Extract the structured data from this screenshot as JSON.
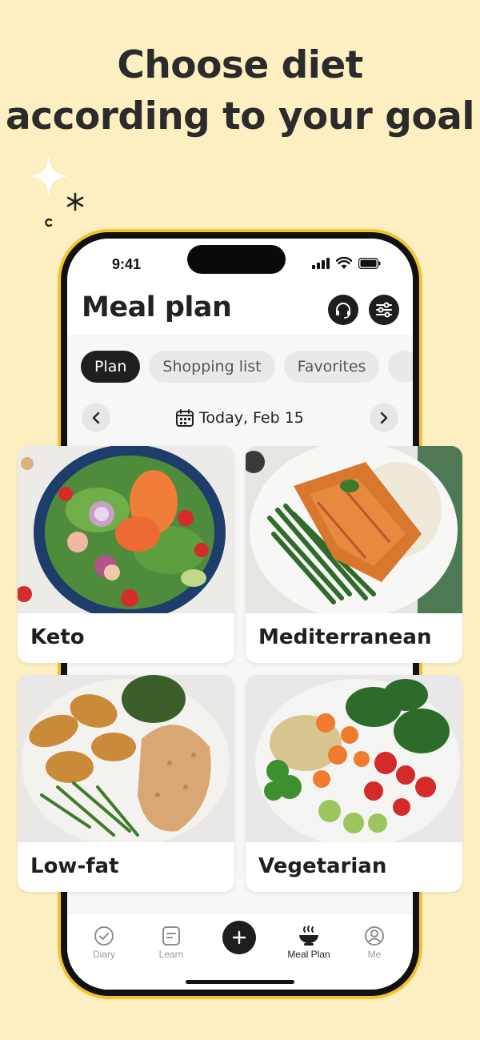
{
  "headline": {
    "line1": "Choose diet",
    "line2": "according to your goal"
  },
  "status_bar": {
    "time": "9:41",
    "icons": [
      "signal-icon",
      "wifi-icon",
      "battery-icon"
    ]
  },
  "header": {
    "title": "Meal plan",
    "buttons": [
      "support-icon",
      "filter-icon"
    ]
  },
  "tabs": [
    {
      "label": "Plan",
      "active": true
    },
    {
      "label": "Shopping list",
      "active": false
    },
    {
      "label": "Favorites",
      "active": false
    }
  ],
  "date_nav": {
    "label": "Today, Feb 15"
  },
  "diets": [
    {
      "label": "Keto"
    },
    {
      "label": "Mediterranean"
    },
    {
      "label": "Low-fat"
    },
    {
      "label": "Vegetarian"
    }
  ],
  "bottom_nav": {
    "items": [
      {
        "label": "Diary",
        "icon": "check-circle-icon",
        "active": false
      },
      {
        "label": "Learn",
        "icon": "document-icon",
        "active": false
      },
      {
        "label": "Meal Plan",
        "icon": "bowl-icon",
        "active": true
      },
      {
        "label": "Me",
        "icon": "profile-icon",
        "active": false
      }
    ],
    "add_icon": "plus-icon"
  },
  "colors": {
    "background": "#FDEFC2",
    "phone_frame": "#F4C430",
    "active_dark": "#1F1F1F"
  }
}
